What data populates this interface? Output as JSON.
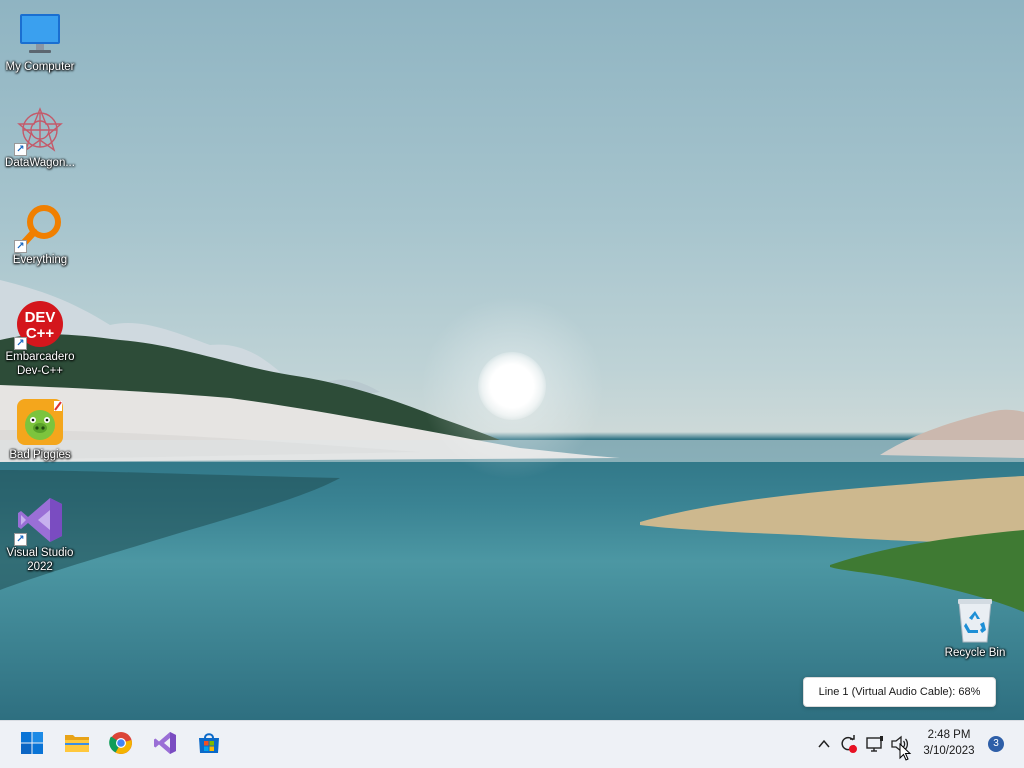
{
  "desktop_icons": [
    {
      "label": "My Computer",
      "icon": "monitor-icon",
      "shortcut": false
    },
    {
      "label": "DataWagon...",
      "icon": "datawagon-icon",
      "shortcut": true
    },
    {
      "label": "Everything",
      "icon": "everything-search-icon",
      "shortcut": true
    },
    {
      "label": "Embarcadero\nDev-C++",
      "icon": "devcpp-icon",
      "icon_text": "DEV\nC++",
      "shortcut": true
    },
    {
      "label": "Bad Piggies",
      "icon": "bad-piggies-icon",
      "shortcut": true
    },
    {
      "label": "Visual Studio\n2022",
      "icon": "visual-studio-icon",
      "shortcut": true
    },
    {
      "label": "Recycle Bin",
      "icon": "recycle-bin-icon",
      "shortcut": false
    }
  ],
  "tooltip": {
    "text": "Line 1 (Virtual Audio Cable): 68%"
  },
  "taskbar": {
    "pinned": [
      {
        "name": "start-button",
        "icon": "windows-logo-icon"
      },
      {
        "name": "file-explorer-button",
        "icon": "folder-icon"
      },
      {
        "name": "chrome-button",
        "icon": "chrome-icon"
      },
      {
        "name": "visual-studio-button",
        "icon": "visual-studio-icon"
      },
      {
        "name": "microsoft-store-button",
        "icon": "store-icon"
      }
    ],
    "tray": {
      "chevron": "^",
      "clock_time": "2:48 PM",
      "clock_date": "3/10/2023",
      "notification_count": "3",
      "volume_percent": 68
    }
  },
  "colors": {
    "taskbar_bg": "#eef1f6",
    "accent": "#0078d4",
    "notif_badge": "#2e5fa8"
  }
}
